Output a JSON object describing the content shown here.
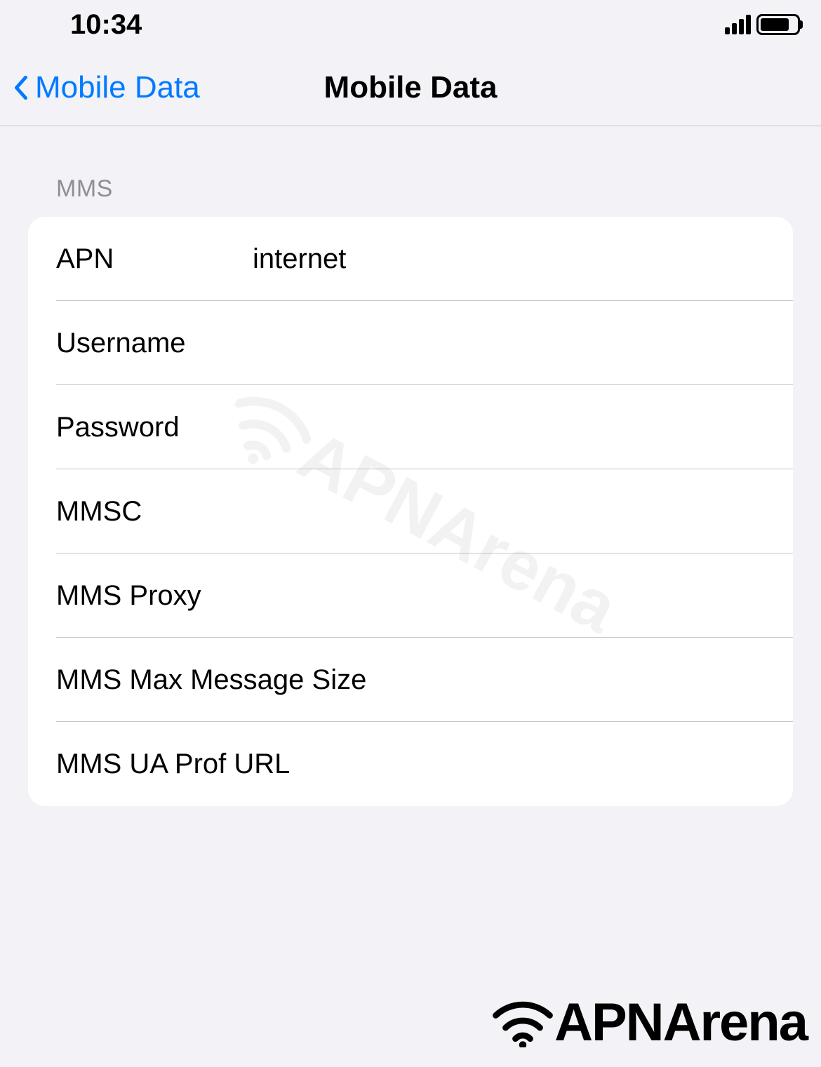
{
  "status": {
    "time": "10:34"
  },
  "nav": {
    "back_label": "Mobile Data",
    "title": "Mobile Data"
  },
  "section": {
    "header": "MMS",
    "rows": [
      {
        "label": "APN",
        "value": "internet"
      },
      {
        "label": "Username",
        "value": ""
      },
      {
        "label": "Password",
        "value": ""
      },
      {
        "label": "MMSC",
        "value": ""
      },
      {
        "label": "MMS Proxy",
        "value": ""
      },
      {
        "label": "MMS Max Message Size",
        "value": ""
      },
      {
        "label": "MMS UA Prof URL",
        "value": ""
      }
    ]
  },
  "watermark": {
    "text": "APNArena"
  },
  "brand": {
    "text": "APNArena"
  }
}
